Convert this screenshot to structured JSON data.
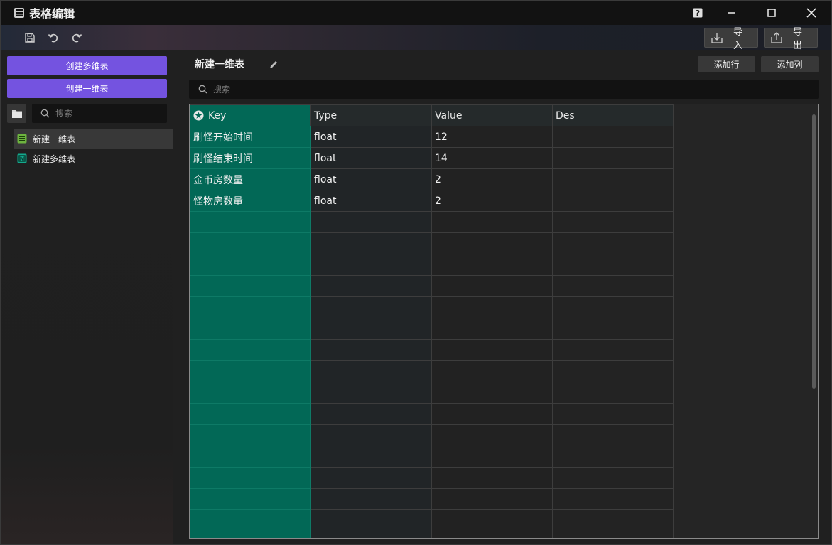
{
  "window": {
    "title": "表格编辑"
  },
  "toolbar": {
    "import_label": "导入",
    "export_label": "导出"
  },
  "sidebar": {
    "create_multi_label": "创建多维表",
    "create_single_label": "创建一维表",
    "search_placeholder": "搜索",
    "items": [
      {
        "label": "新建一维表",
        "icon": "table-icon",
        "selected": true
      },
      {
        "label": "新建多维表",
        "icon": "multi-table-icon",
        "selected": false
      }
    ]
  },
  "main": {
    "sheet_title": "新建一维表",
    "add_row_label": "添加行",
    "add_col_label": "添加列",
    "search_placeholder": "搜索",
    "columns": [
      "Key",
      "Type",
      "Value",
      "Des"
    ],
    "rows": [
      {
        "key": "刷怪开始时间",
        "type": "float",
        "value": "12",
        "des": ""
      },
      {
        "key": "刷怪结束时间",
        "type": "float",
        "value": "14",
        "des": ""
      },
      {
        "key": "金币房数量",
        "type": "float",
        "value": "2",
        "des": ""
      },
      {
        "key": "怪物房数量",
        "type": "float",
        "value": "2",
        "des": ""
      }
    ]
  },
  "colors": {
    "accent_purple": "#7453e0",
    "key_column": "#026856"
  }
}
